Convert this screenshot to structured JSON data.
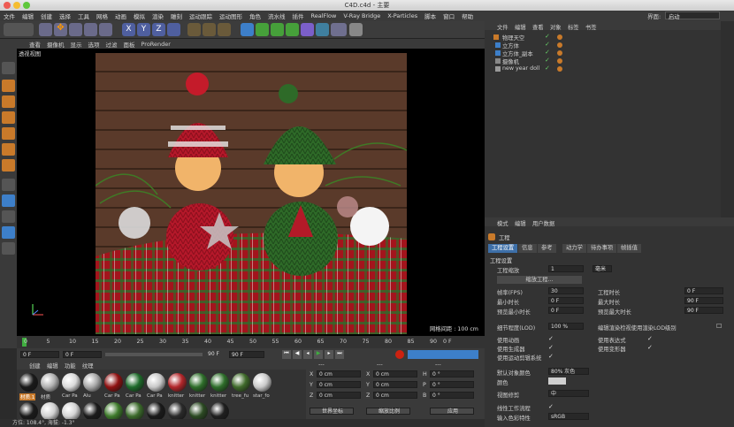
{
  "window": {
    "title": "C4D.c4d - 主要",
    "layout_label": "界面:",
    "layout_value": "启动"
  },
  "menu": [
    "文件",
    "编辑",
    "创建",
    "选择",
    "工具",
    "网格",
    "动画",
    "模拟",
    "渲染",
    "雕刻",
    "运动跟踪",
    "运动图形",
    "角色",
    "流水线",
    "插件",
    "RealFlow",
    "V-Ray Bridge",
    "X-Particles",
    "脚本",
    "窗口",
    "帮助"
  ],
  "toolbar": {
    "axes": [
      "X",
      "Y",
      "Z"
    ]
  },
  "viewport": {
    "menu": [
      "查看",
      "摄像机",
      "显示",
      "选项",
      "过滤",
      "面板",
      "ProRender"
    ],
    "label": "透视视图",
    "grid_info": "网格间距 : 100 cm"
  },
  "timeline": {
    "ticks": [
      "0",
      "5",
      "10",
      "15",
      "20",
      "25",
      "30",
      "35",
      "40",
      "45",
      "50",
      "55",
      "60",
      "65",
      "70",
      "75",
      "80",
      "85",
      "90"
    ],
    "end_label": "0 F"
  },
  "transport": {
    "start": "0 F",
    "current": "0 F",
    "end": "90 F",
    "end2": "90 F"
  },
  "materials": {
    "menu": [
      "创建",
      "编辑",
      "功能",
      "纹理"
    ],
    "row1": [
      {
        "label": "材质.1",
        "color": "#1a1a1a"
      },
      {
        "label": "材质",
        "color": "#b0b0b0"
      },
      {
        "label": "Car Pa",
        "color": "#d9d9d9"
      },
      {
        "label": "Alu",
        "color": "#a8a8a8"
      },
      {
        "label": "Car Pa",
        "color": "#8f1111"
      },
      {
        "label": "Car Pa",
        "color": "#1d6b2a"
      },
      {
        "label": "Car Pa",
        "color": "#c8c8c8"
      },
      {
        "label": "knitter",
        "color": "#b2262a"
      },
      {
        "label": "knitter",
        "color": "#2e6e2a"
      },
      {
        "label": "knitter",
        "color": "#2e6e2a"
      },
      {
        "label": "tree_fu",
        "color": "#3f6a2a"
      },
      {
        "label": "star_fo",
        "color": "#c9c9c9"
      }
    ],
    "row2_colors": [
      "#1a1a1a",
      "#cfcfcf",
      "#d4d4d4",
      "#1b1b1b",
      "#3d7a2a",
      "#3b6a2b",
      "#1a1a1a",
      "#2a2a2a",
      "#2c4a23",
      "#1f1f1f"
    ]
  },
  "coords": {
    "header": [
      "---",
      "---",
      "---"
    ],
    "rows": [
      {
        "a": "X",
        "av": "0 cm",
        "b": "X",
        "bv": "0 cm",
        "c": "H",
        "cv": "0 °"
      },
      {
        "a": "Y",
        "av": "0 cm",
        "b": "Y",
        "bv": "0 cm",
        "c": "P",
        "cv": "0 °"
      },
      {
        "a": "Z",
        "av": "0 cm",
        "b": "Z",
        "bv": "0 cm",
        "c": "B",
        "cv": "0 °"
      }
    ],
    "world": "世界坐标",
    "scale": "缩放比例",
    "apply": "应用"
  },
  "status": "方位: 108.4°, 海拔: -1.3°",
  "object_manager": {
    "menu": [
      "文件",
      "编辑",
      "查看",
      "对象",
      "标签",
      "书签"
    ],
    "objects": [
      "物理天空",
      "立方体",
      "立方体_副本",
      "摄像机",
      "new year doll"
    ]
  },
  "attr": {
    "menu": [
      "模式",
      "编辑",
      "用户数据"
    ],
    "title": "工程",
    "tabs": [
      "工程设置",
      "信息",
      "参考",
      "动力学",
      "待办事项",
      "帧插值"
    ],
    "section": "工程设置",
    "scale_label": "工程缩放",
    "scale_value": "1",
    "scale_unit": "毫米",
    "scale_btn": "缩放工程...",
    "left_fields": [
      {
        "label": "帧率(FPS)",
        "value": "30"
      },
      {
        "label": "最小时长",
        "value": "0 F"
      },
      {
        "label": "预览最小时长",
        "value": "0 F"
      }
    ],
    "right_fields": [
      {
        "label": "工程时长",
        "value": "0 F"
      },
      {
        "label": "最大时长",
        "value": "90 F"
      },
      {
        "label": "预览最大时长",
        "value": "90 F"
      }
    ],
    "lod_label": "细节程度(LOD)",
    "lod_value": "100 %",
    "lod_check": "编辑渲染检视使用渲染LOD级别",
    "checks_left": [
      "使用动画",
      "使用生成器",
      "使用运动剪辑系统"
    ],
    "checks_right": [
      "使用表达式",
      "使用变形器"
    ],
    "default_color_label": "默认对象颜色",
    "default_color_value": "80% 灰色",
    "color_label": "颜色",
    "view_clip_label": "视图修剪",
    "view_clip_value": "中",
    "linear_label": "线性工作流程",
    "input_color_label": "输入色彩特性",
    "input_color_value": "sRGB"
  }
}
